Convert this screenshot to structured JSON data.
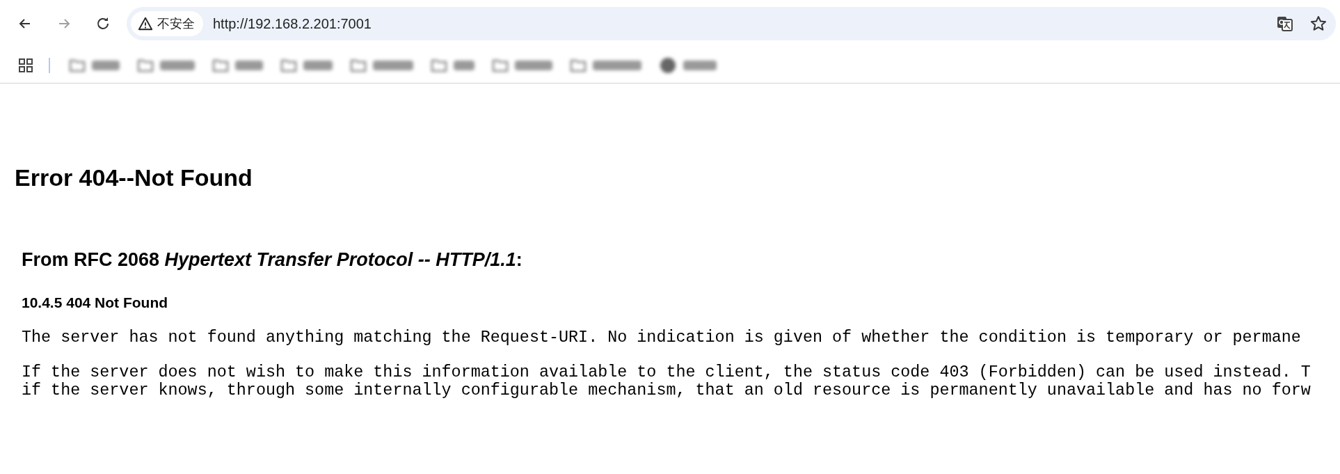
{
  "nav_buttons": [
    {
      "kind": "back",
      "disabled": false
    },
    {
      "kind": "forward",
      "disabled": true
    },
    {
      "kind": "reload",
      "disabled": false
    }
  ],
  "address_bar": {
    "security_label": "不安全",
    "url": "http://192.168.2.201:7001"
  },
  "bookmarks": [
    {
      "kind": "folder"
    },
    {
      "kind": "folder"
    },
    {
      "kind": "folder"
    },
    {
      "kind": "folder"
    },
    {
      "kind": "folder"
    },
    {
      "kind": "folder"
    },
    {
      "kind": "folder"
    },
    {
      "kind": "folder"
    },
    {
      "kind": "site"
    }
  ],
  "page": {
    "title": "Error 404--Not Found",
    "source_heading": "From RFC 2068 *Hypertext Transfer Protocol -- HTTP/1.1*:",
    "section_heading": "10.4.5 404 Not Found",
    "paragraphs": [
      [
        "The server has not found anything matching the Request-URI. No indication is given of whether the condition is temporary or permane"
      ],
      [
        "If the server does not wish to make this information available to the client, the status code 403 (Forbidden) can be used instead. T",
        "if the server knows, through some internally configurable mechanism, that an old resource is permanently unavailable and has no forw"
      ]
    ]
  }
}
